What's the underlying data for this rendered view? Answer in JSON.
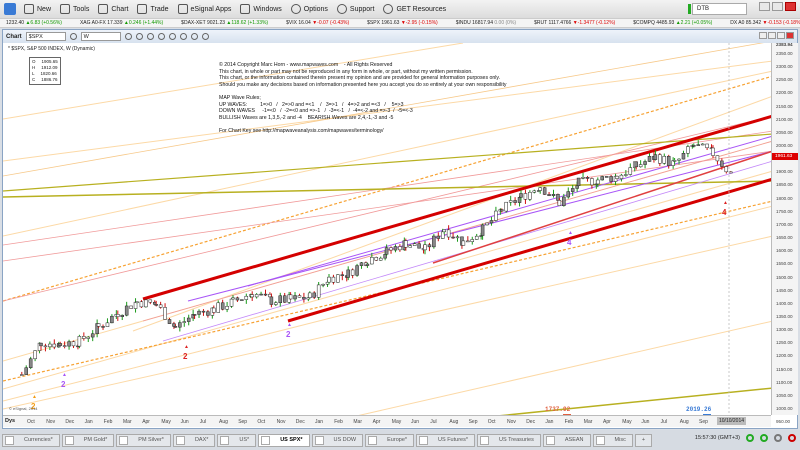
{
  "menu": {
    "items": [
      {
        "label": "New",
        "icon": "new-icon"
      },
      {
        "label": "Tools",
        "icon": "tools-icon"
      },
      {
        "label": "Chart",
        "icon": "chart-icon"
      },
      {
        "label": "Trade",
        "icon": "trade-icon"
      },
      {
        "label": "eSignal Apps",
        "icon": "apps-icon"
      },
      {
        "label": "Windows",
        "icon": "windows-icon"
      },
      {
        "label": "Options",
        "icon": "gear-icon"
      },
      {
        "label": "Support",
        "icon": "help-icon"
      },
      {
        "label": "GET Resources",
        "icon": "resources-icon"
      }
    ],
    "search_value": "DTB"
  },
  "ticker": [
    {
      "sym": "",
      "last": "1232.40",
      "chg": "▲6.83 (+0.56%)",
      "dir": "up"
    },
    {
      "sym": "XAG A0-FX",
      "last": "17.339",
      "chg": "▲0.246 (+1.44%)",
      "dir": "up"
    },
    {
      "sym": "$DAX-XET",
      "last": "9021.23",
      "chg": "▲118.62 (+1.33%)",
      "dir": "up"
    },
    {
      "sym": "$VIX",
      "last": "16.04",
      "chg": "▼-0.07 (-0.43%)",
      "dir": "dn"
    },
    {
      "sym": "$SPX",
      "last": "1961.63",
      "chg": "▼-2.95 (-0.15%)",
      "dir": "dn"
    },
    {
      "sym": "$INDU",
      "last": "16817.94",
      "chg": "0.00 (0%)",
      "dir": "nc"
    },
    {
      "sym": "$RUT",
      "last": "1117.4766",
      "chg": "▼-1.3477 (-0.12%)",
      "dir": "dn"
    },
    {
      "sym": "$COMPQ",
      "last": "4485.93",
      "chg": "▲2.21 (+0.05%)",
      "dir": "up"
    },
    {
      "sym": "DX A0",
      "last": "85.342",
      "chg": "▼-0.153 (-0.18%)",
      "dir": "dn"
    }
  ],
  "chart": {
    "title": "Chart",
    "symbol": "$SPX",
    "interval": "W",
    "description": "* $SPX, S&P 500 INDEX, W (Dynamic)",
    "ohlc": [
      [
        "O",
        "1905.65"
      ],
      [
        "H",
        "1912.09"
      ],
      [
        "L",
        "1820.66"
      ],
      [
        "C",
        "1886.76"
      ]
    ],
    "notice": "© 2014 Copyright Marc Horn - www.mapwaves.com    - All Rights Reserved\nThis chart, in whole or part may not be reproduced in any form in whole, or part, without my written permission.\nThis chart, or the information contained therein present my opinion and are provided for general information purposes only.\nShould you make any decisions based on information presented here you accept you do so entirely at your own responsibility\n\nMAP Wave Rules;\nUP WAVES:         1=>0   /   2=>0 and =<1    /   3=>1   /   4=>2 and =<3   /    5=>3\nDOWN WAVES     -1=<0   /  -2=<0 and =>-1   /  -3=<-1   /  -4=<-2 and =>-3  /  -5=<-3\nBULLISH Waves are 1,3,5,-2 and -4    BEARISH Waves are 2,4,-1,-3 and -5\n\nFor Chart Key see http://mapwaveanalysis.com/mapwaves/terminology/",
    "watermark": "© eSignal, 2014",
    "days_label": "Dys",
    "date_tag": "10/10/2014",
    "last_price": "1961.63",
    "top_price": "2383.94",
    "wave_labels": [
      {
        "t": "2",
        "c": "#f39c12"
      },
      {
        "t": "2",
        "c": "#a855f7"
      },
      {
        "t": "2",
        "c": "#d22"
      },
      {
        "t": "2",
        "c": "#a855f7"
      },
      {
        "t": "4",
        "c": "#a855f7"
      },
      {
        "t": "4",
        "c": "#d22"
      }
    ],
    "low_label": "1737.92",
    "high_label": "2019.26",
    "low_marker": "L",
    "high_marker": "H"
  },
  "chart_data": {
    "type": "candlestick",
    "title": "$SPX, S&P 500 INDEX, W",
    "ylim": [
      950,
      2383.94
    ],
    "yticks": [
      "2350.00",
      "2300.00",
      "2250.00",
      "2200.00",
      "2150.00",
      "2100.00",
      "2050.00",
      "2000.00",
      "1950.00",
      "1900.00",
      "1850.00",
      "1800.00",
      "1750.00",
      "1700.00",
      "1650.00",
      "1600.00",
      "1550.00",
      "1500.00",
      "1450.00",
      "1400.00",
      "1350.00",
      "1300.00",
      "1250.00",
      "1200.00",
      "1150.00",
      "1100.00",
      "1050.00",
      "1000.00",
      "950.00"
    ],
    "xticks": [
      "Oct",
      "Nov",
      "Dec",
      "Jan",
      "Feb",
      "Mar",
      "Apr",
      "May",
      "Jun",
      "Jul",
      "Aug",
      "Sep",
      "Oct",
      "Nov",
      "Dec",
      "Jan",
      "Feb",
      "Mar",
      "Apr",
      "May",
      "Jun",
      "Jul",
      "Aug",
      "Sep",
      "Oct",
      "Nov",
      "Dec",
      "Jan",
      "Feb",
      "Mar",
      "Apr",
      "May",
      "Jun",
      "Jul",
      "Aug",
      "Sep"
    ],
    "monthly_close_approx": [
      1131,
      1253,
      1247,
      1258,
      1312,
      1366,
      1408,
      1398,
      1310,
      1362,
      1379,
      1407,
      1441,
      1412,
      1416,
      1426,
      1498,
      1515,
      1569,
      1598,
      1631,
      1606,
      1686,
      1633,
      1682,
      1757,
      1806,
      1848,
      1783,
      1859,
      1872,
      1884,
      1924,
      1960,
      1931,
      2003,
      1972,
      1886
    ]
  },
  "tabs": [
    {
      "label": "Currencies*"
    },
    {
      "label": "PM Gold*"
    },
    {
      "label": "PM Silver*"
    },
    {
      "label": "DAX*"
    },
    {
      "label": "US*"
    },
    {
      "label": "US SPX*",
      "active": true
    },
    {
      "label": "US DOW"
    },
    {
      "label": "Europe*"
    },
    {
      "label": "US Futures*"
    },
    {
      "label": "US Treasuries"
    },
    {
      "label": "ASEAN"
    },
    {
      "label": "Misc"
    }
  ],
  "add_tab": "+",
  "status_time": "15:57:30 (GMT+3)"
}
